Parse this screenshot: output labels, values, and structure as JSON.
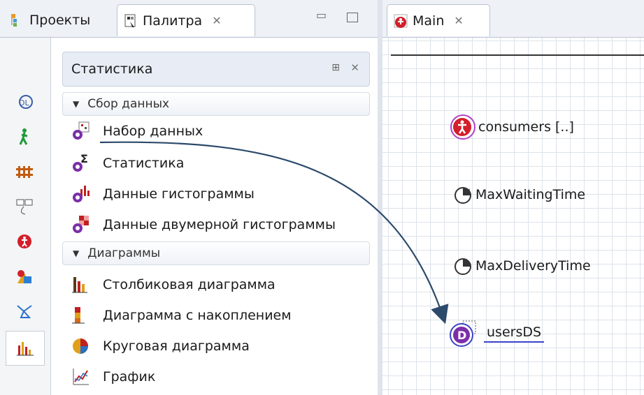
{
  "left_tabs": {
    "projects": "Проекты",
    "palette": "Палитра"
  },
  "editor_tab": {
    "label": "Main"
  },
  "palette": {
    "header": "Статистика",
    "groups": [
      {
        "label": "Сбор данных",
        "items": [
          {
            "label": "Набор данных",
            "icon": "dataset-icon"
          },
          {
            "label": "Статистика",
            "icon": "statistics-icon"
          },
          {
            "label": "Данные гистограммы",
            "icon": "histogram-data-icon"
          },
          {
            "label": "Данные двумерной гистограммы",
            "icon": "histogram-2d-data-icon"
          }
        ]
      },
      {
        "label": "Диаграммы",
        "items": [
          {
            "label": "Столбиковая диаграмма",
            "icon": "bar-chart-icon"
          },
          {
            "label": "Диаграмма с накоплением",
            "icon": "stack-chart-icon"
          },
          {
            "label": "Круговая диаграмма",
            "icon": "pie-chart-icon"
          },
          {
            "label": "График",
            "icon": "plot-icon"
          }
        ]
      }
    ]
  },
  "canvas": {
    "items": [
      {
        "label": "consumers [..]",
        "icon": "agent-population-icon"
      },
      {
        "label": "MaxWaitingTime",
        "icon": "parameter-icon"
      },
      {
        "label": "MaxDeliveryTime",
        "icon": "parameter-icon"
      },
      {
        "label": "usersDS",
        "icon": "dataset-icon"
      }
    ]
  },
  "colors": {
    "accent_purple": "#7b2fa8",
    "agent_red": "#d21f2b",
    "arrow": "#2c4a6b"
  }
}
